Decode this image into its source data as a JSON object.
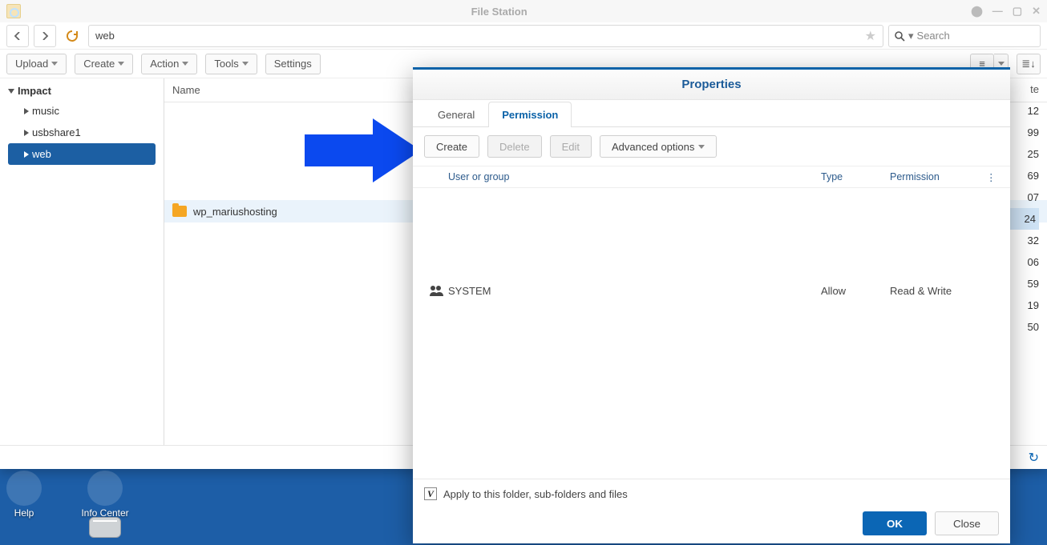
{
  "window": {
    "title": "File Station",
    "path_value": "web",
    "search_placeholder": "Search"
  },
  "toolbar": {
    "upload": "Upload",
    "create": "Create",
    "action": "Action",
    "tools": "Tools",
    "settings": "Settings"
  },
  "tree": {
    "root": "Impact",
    "items": [
      "music",
      "usbshare1",
      "web"
    ],
    "active_index": 2
  },
  "list": {
    "column_name": "Name",
    "rows": [
      {
        "name": "wp_mariushosting"
      }
    ]
  },
  "size_column": {
    "header": "te",
    "values": [
      "12",
      "99",
      "25",
      "69",
      "07",
      "24",
      "32",
      "06",
      "59",
      "19",
      "50"
    ],
    "highlight_index": 5
  },
  "dialog": {
    "title": "Properties",
    "tabs": {
      "general": "General",
      "permission": "Permission"
    },
    "toolbar": {
      "create": "Create",
      "delete": "Delete",
      "edit": "Edit",
      "advanced": "Advanced options"
    },
    "columns": {
      "user_or_group": "User or group",
      "type": "Type",
      "permission": "Permission"
    },
    "rows": [
      {
        "name": "SYSTEM",
        "type": "Allow",
        "permission": "Read & Write"
      }
    ],
    "apply_label": "Apply to this folder, sub-folders and files",
    "apply_check": "V",
    "ok": "OK",
    "close": "Close"
  },
  "desktop": {
    "help": "Help",
    "info_center": "Info Center"
  }
}
